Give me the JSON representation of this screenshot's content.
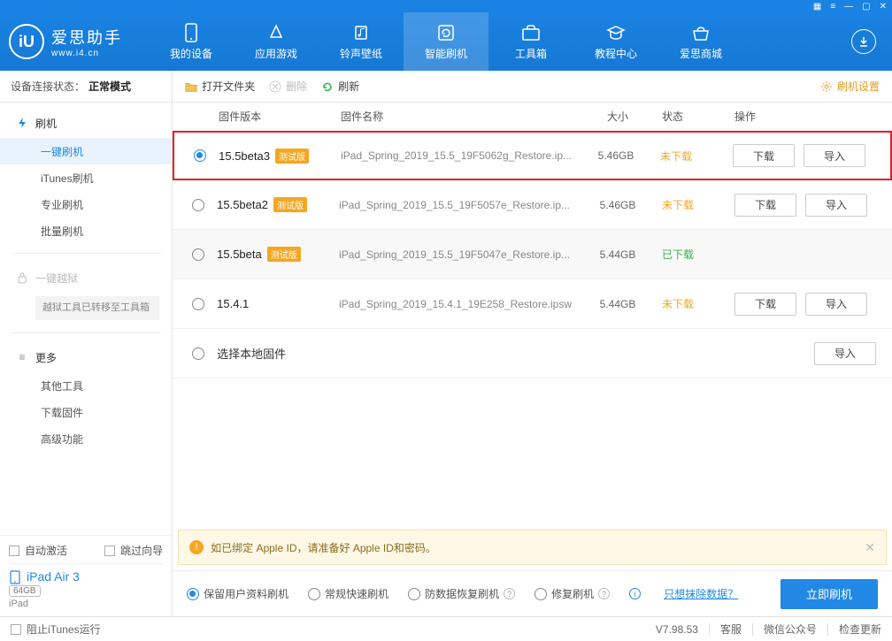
{
  "logo": {
    "title": "爱思助手",
    "url": "www.i4.cn",
    "badge": "iU"
  },
  "topnav": [
    {
      "label": "我的设备"
    },
    {
      "label": "应用游戏"
    },
    {
      "label": "铃声壁纸"
    },
    {
      "label": "智能刷机"
    },
    {
      "label": "工具箱"
    },
    {
      "label": "教程中心"
    },
    {
      "label": "爱思商城"
    }
  ],
  "conn": {
    "label": "设备连接状态：",
    "value": "正常模式"
  },
  "sidebar": {
    "flash_head": "刷机",
    "items": [
      "一键刷机",
      "iTunes刷机",
      "专业刷机",
      "批量刷机"
    ],
    "jailbreak_head": "一键越狱",
    "jailbreak_note": "越狱工具已转移至工具箱",
    "more_head": "更多",
    "more_items": [
      "其他工具",
      "下载固件",
      "高级功能"
    ]
  },
  "side_bottom": {
    "auto_activate": "自动激活",
    "skip_guide": "跳过向导",
    "device_name": "iPad Air 3",
    "capacity": "64GB",
    "device_type": "iPad"
  },
  "toolbar": {
    "open": "打开文件夹",
    "delete": "删除",
    "refresh": "刷新",
    "settings": "刷机设置"
  },
  "columns": {
    "version": "固件版本",
    "name": "固件名称",
    "size": "大小",
    "status": "状态",
    "ops": "操作"
  },
  "rows": [
    {
      "version": "15.5beta3",
      "beta": "测试版",
      "name": "iPad_Spring_2019_15.5_19F5062g_Restore.ip...",
      "size": "5.46GB",
      "status": "未下载",
      "status_cls": "st-nodl",
      "download": "下载",
      "import": "导入",
      "checked": true,
      "alt": false,
      "highlight": true,
      "show_dl": true
    },
    {
      "version": "15.5beta2",
      "beta": "测试版",
      "name": "iPad_Spring_2019_15.5_19F5057e_Restore.ip...",
      "size": "5.46GB",
      "status": "未下载",
      "status_cls": "st-nodl",
      "download": "下载",
      "import": "导入",
      "checked": false,
      "alt": false,
      "highlight": false,
      "show_dl": true
    },
    {
      "version": "15.5beta",
      "beta": "测试版",
      "name": "iPad_Spring_2019_15.5_19F5047e_Restore.ip...",
      "size": "5.44GB",
      "status": "已下载",
      "status_cls": "st-dl",
      "download": "",
      "import": "",
      "checked": false,
      "alt": true,
      "highlight": false,
      "show_dl": false
    },
    {
      "version": "15.4.1",
      "beta": "",
      "name": "iPad_Spring_2019_15.4.1_19E258_Restore.ipsw",
      "size": "5.44GB",
      "status": "未下载",
      "status_cls": "st-nodl",
      "download": "下载",
      "import": "导入",
      "checked": false,
      "alt": false,
      "highlight": false,
      "show_dl": true
    }
  ],
  "local_row": {
    "label": "选择本地固件",
    "import": "导入"
  },
  "warn": "如已绑定 Apple ID，请准备好 Apple ID和密码。",
  "modes": {
    "keep": "保留用户资料刷机",
    "normal": "常规快速刷机",
    "anti": "防数据恢复刷机",
    "repair": "修复刷机",
    "erase": "只想抹除数据？",
    "go": "立即刷机"
  },
  "statusbar": {
    "block_itunes": "阻止iTunes运行",
    "version": "V7.98.53",
    "kefu": "客服",
    "wechat": "微信公众号",
    "update": "检查更新"
  }
}
